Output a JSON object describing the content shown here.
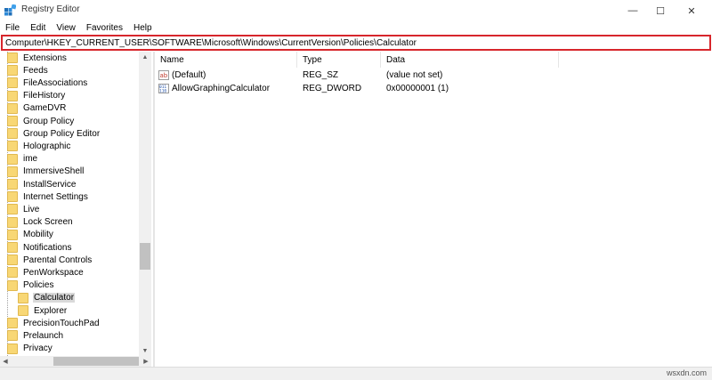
{
  "window": {
    "title": "Registry Editor",
    "minimize_glyph": "—",
    "maximize_glyph": "☐",
    "close_glyph": "✕"
  },
  "menu": [
    "File",
    "Edit",
    "View",
    "Favorites",
    "Help"
  ],
  "address": {
    "path": "Computer\\HKEY_CURRENT_USER\\SOFTWARE\\Microsoft\\Windows\\CurrentVersion\\Policies\\Calculator"
  },
  "tree": {
    "items": [
      {
        "label": "Extensions",
        "level": 0
      },
      {
        "label": "Feeds",
        "level": 0
      },
      {
        "label": "FileAssociations",
        "level": 0
      },
      {
        "label": "FileHistory",
        "level": 0
      },
      {
        "label": "GameDVR",
        "level": 0
      },
      {
        "label": "Group Policy",
        "level": 0
      },
      {
        "label": "Group Policy Editor",
        "level": 0
      },
      {
        "label": "Holographic",
        "level": 0
      },
      {
        "label": "ime",
        "level": 0
      },
      {
        "label": "ImmersiveShell",
        "level": 0
      },
      {
        "label": "InstallService",
        "level": 0
      },
      {
        "label": "Internet Settings",
        "level": 0
      },
      {
        "label": "Live",
        "level": 0
      },
      {
        "label": "Lock Screen",
        "level": 0
      },
      {
        "label": "Mobility",
        "level": 0
      },
      {
        "label": "Notifications",
        "level": 0
      },
      {
        "label": "Parental Controls",
        "level": 0
      },
      {
        "label": "PenWorkspace",
        "level": 0
      },
      {
        "label": "Policies",
        "level": 0
      },
      {
        "label": "Calculator",
        "level": 1,
        "selected": true
      },
      {
        "label": "Explorer",
        "level": 1
      },
      {
        "label": "PrecisionTouchPad",
        "level": 0
      },
      {
        "label": "Prelaunch",
        "level": 0
      },
      {
        "label": "Privacy",
        "level": 0
      }
    ]
  },
  "values": {
    "columns": [
      "Name",
      "Type",
      "Data"
    ],
    "rows": [
      {
        "name": "(Default)",
        "type": "REG_SZ",
        "data": "(value not set)",
        "icon": "string-value-icon"
      },
      {
        "name": "AllowGraphingCalculator",
        "type": "REG_DWORD",
        "data": "0x00000001 (1)",
        "icon": "binary-value-icon"
      }
    ]
  },
  "watermark": "wsxdn.com",
  "colors": {
    "address_highlight": "#d7262c",
    "folder": "#f8d775",
    "selection": "#d9d9d9"
  }
}
